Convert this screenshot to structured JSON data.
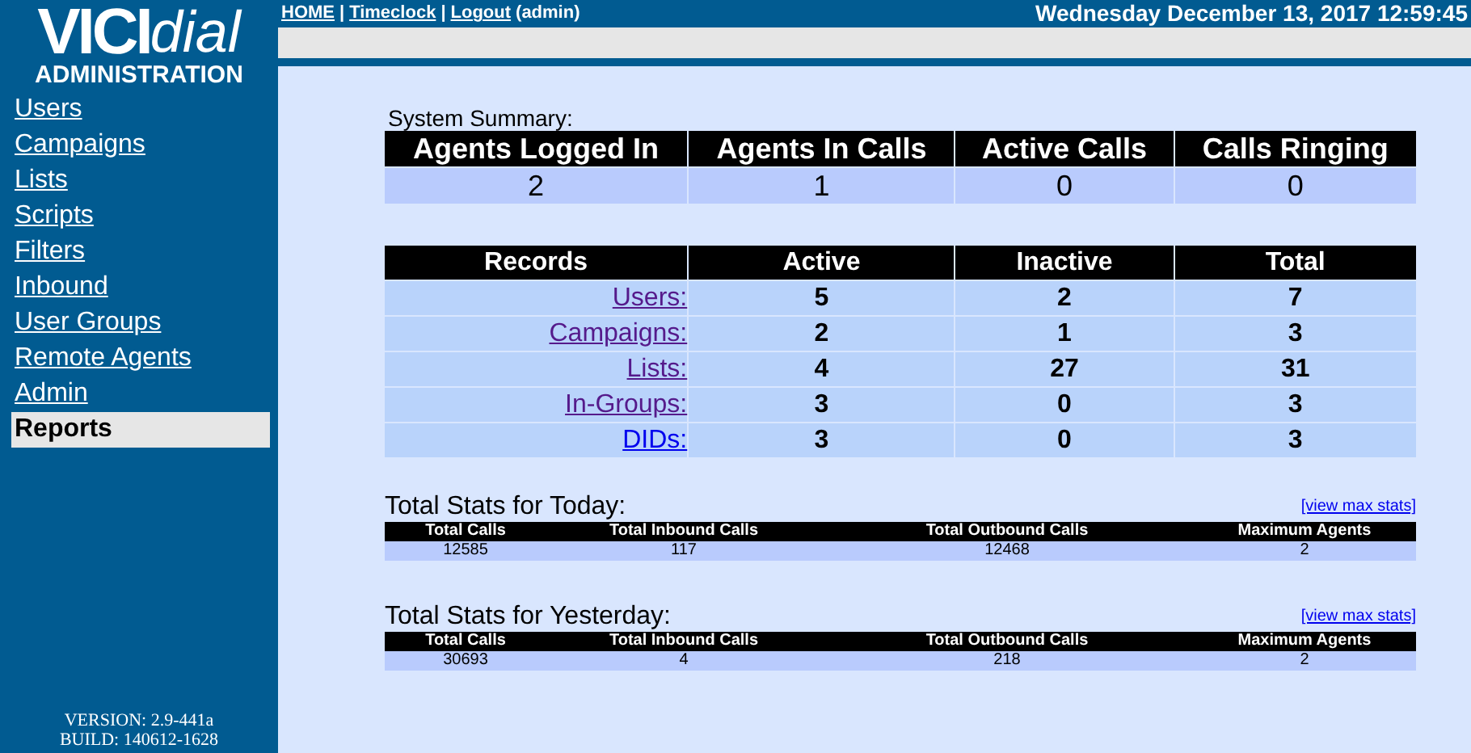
{
  "logo": {
    "strong": "VICI",
    "light": "dial",
    "subtitle": "ADMINISTRATION"
  },
  "sidebar": {
    "items": [
      {
        "label": "Users",
        "selected": false
      },
      {
        "label": "Campaigns",
        "selected": false
      },
      {
        "label": "Lists",
        "selected": false
      },
      {
        "label": "Scripts",
        "selected": false
      },
      {
        "label": "Filters",
        "selected": false
      },
      {
        "label": "Inbound",
        "selected": false
      },
      {
        "label": "User Groups",
        "selected": false
      },
      {
        "label": "Remote Agents",
        "selected": false
      },
      {
        "label": "Admin",
        "selected": false
      },
      {
        "label": "Reports",
        "selected": true
      }
    ],
    "version": "VERSION: 2.9-441a",
    "build": "BUILD: 140612-1628"
  },
  "top_nav": {
    "links": [
      "HOME",
      "Timeclock",
      "Logout"
    ],
    "separator": "|",
    "user": "(admin)",
    "datetime": "Wednesday December 13, 2017 12:59:45"
  },
  "system_summary": {
    "title": "System Summary:",
    "columns": [
      "Agents Logged In",
      "Agents In Calls",
      "Active Calls",
      "Calls Ringing"
    ],
    "values": [
      "2",
      "1",
      "0",
      "0"
    ]
  },
  "records": {
    "columns": [
      "Records",
      "Active",
      "Inactive",
      "Total"
    ],
    "rows": [
      {
        "label": "Users:",
        "visited": true,
        "active": "5",
        "inactive": "2",
        "total": "7"
      },
      {
        "label": "Campaigns:",
        "visited": true,
        "active": "2",
        "inactive": "1",
        "total": "3"
      },
      {
        "label": "Lists:",
        "visited": true,
        "active": "4",
        "inactive": "27",
        "total": "31"
      },
      {
        "label": "In-Groups:",
        "visited": true,
        "active": "3",
        "inactive": "0",
        "total": "3"
      },
      {
        "label": "DIDs:",
        "visited": false,
        "active": "3",
        "inactive": "0",
        "total": "3"
      }
    ]
  },
  "stats": [
    {
      "title": "Total Stats for Today:",
      "link": "[view max stats]",
      "columns": [
        "Total Calls",
        "Total Inbound Calls",
        "Total Outbound Calls",
        "Maximum Agents"
      ],
      "values": [
        "12585",
        "117",
        "12468",
        "2"
      ]
    },
    {
      "title": "Total Stats for Yesterday:",
      "link": "[view max stats]",
      "columns": [
        "Total Calls",
        "Total Inbound Calls",
        "Total Outbound Calls",
        "Maximum Agents"
      ],
      "values": [
        "30693",
        "4",
        "218",
        "2"
      ]
    }
  ]
}
